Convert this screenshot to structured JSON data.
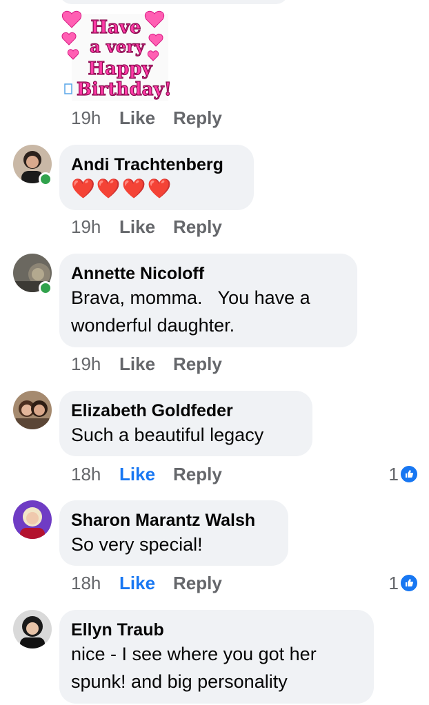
{
  "sticker": {
    "line1": "Have",
    "line2": "a very",
    "line3": "Happy",
    "line4": "Birthday!"
  },
  "comments": [
    {
      "time": "19h",
      "like": "Like",
      "reply": "Reply"
    },
    {
      "name": "Andi Trachtenberg",
      "text": "❤️❤️❤️❤️",
      "time": "19h",
      "like": "Like",
      "reply": "Reply"
    },
    {
      "name": "Annette Nicoloff",
      "text_line1": "Brava, momma.   You have a",
      "text_line2": "wonderful daughter.",
      "time": "19h",
      "like": "Like",
      "reply": "Reply"
    },
    {
      "name": "Elizabeth Goldfeder",
      "text": "Such a beautiful legacy",
      "time": "18h",
      "like": "Like",
      "reply": "Reply",
      "reaction_count": "1"
    },
    {
      "name": "Sharon Marantz Walsh",
      "text": "So very special!",
      "time": "18h",
      "like": "Like",
      "reply": "Reply",
      "reaction_count": "1"
    },
    {
      "name": "Ellyn Traub",
      "text_line1": "nice - I see where you got her",
      "text_line2": "spunk! and big personality"
    }
  ],
  "colors": {
    "bubble": "#f0f2f5",
    "meta": "#65676b",
    "liked": "#1877f2",
    "online": "#31a24c"
  }
}
